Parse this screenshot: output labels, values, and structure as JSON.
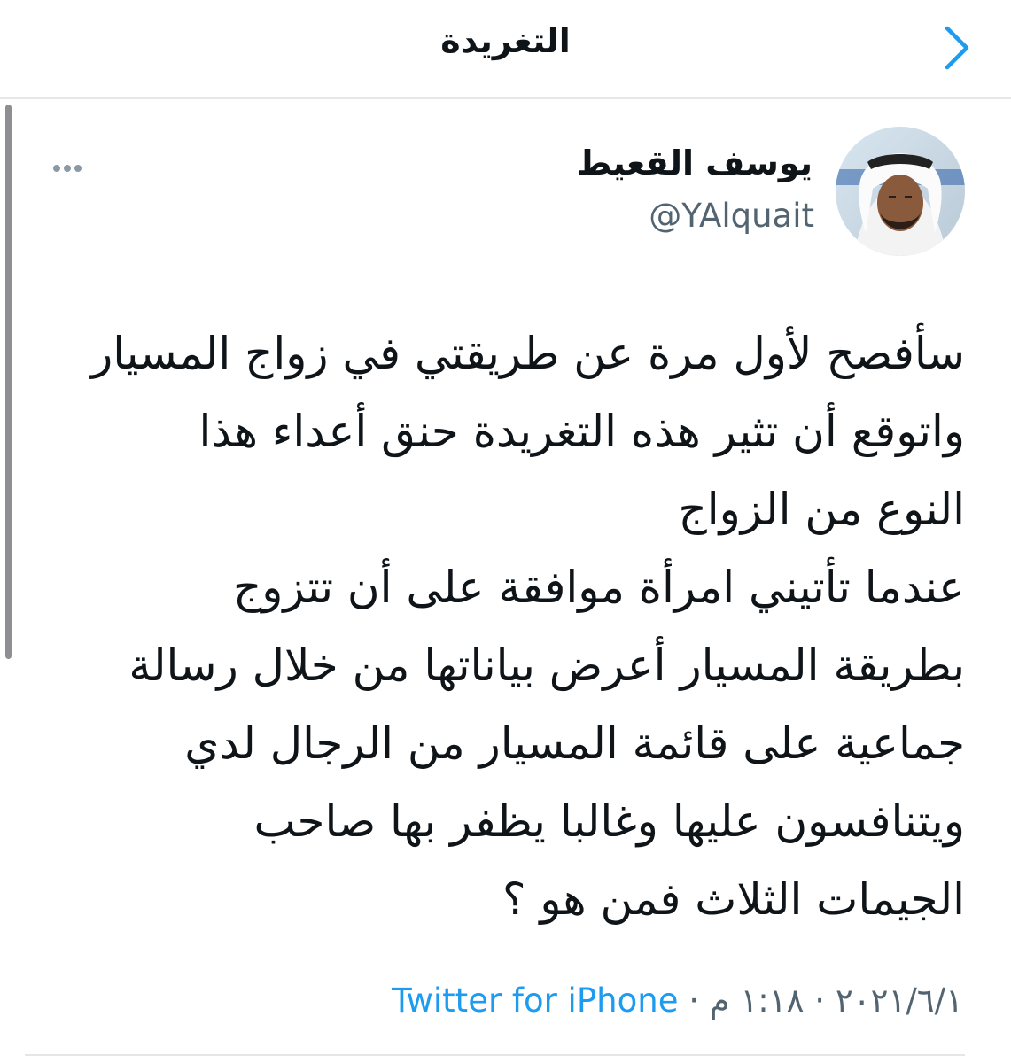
{
  "header": {
    "title": "التغريدة",
    "back_icon": "chevron-right-icon"
  },
  "author": {
    "display_name": "يوسف القعيط",
    "handle": "@YAlquait",
    "avatar": "avatar-photo"
  },
  "more_icon": "more-horizontal-icon",
  "tweet": {
    "lines": [
      "سأفصح لأول مرة عن طريقتي في زواج المسيار",
      "واتوقع أن تثير هذه التغريدة حنق أعداء هذا",
      "النوع من الزواج",
      "عندما تأتيني امرأة موافقة على أن تتزوج",
      "بطريقة المسيار أعرض بياناتها من خلال رسالة",
      "جماعية على قائمة المسيار من الرجال لدي",
      "ويتنافسون عليها وغالبا يظفر بها صاحب",
      "الجيمات الثلاث فمن هو ؟"
    ]
  },
  "meta": {
    "date": "٢٠٢١/٦/١",
    "separator": "·",
    "time": "١:١٨ م",
    "source": "Twitter for iPhone"
  },
  "colors": {
    "accent": "#1d9bf0",
    "secondary_text": "#536471",
    "divider": "#e6e6e6"
  }
}
